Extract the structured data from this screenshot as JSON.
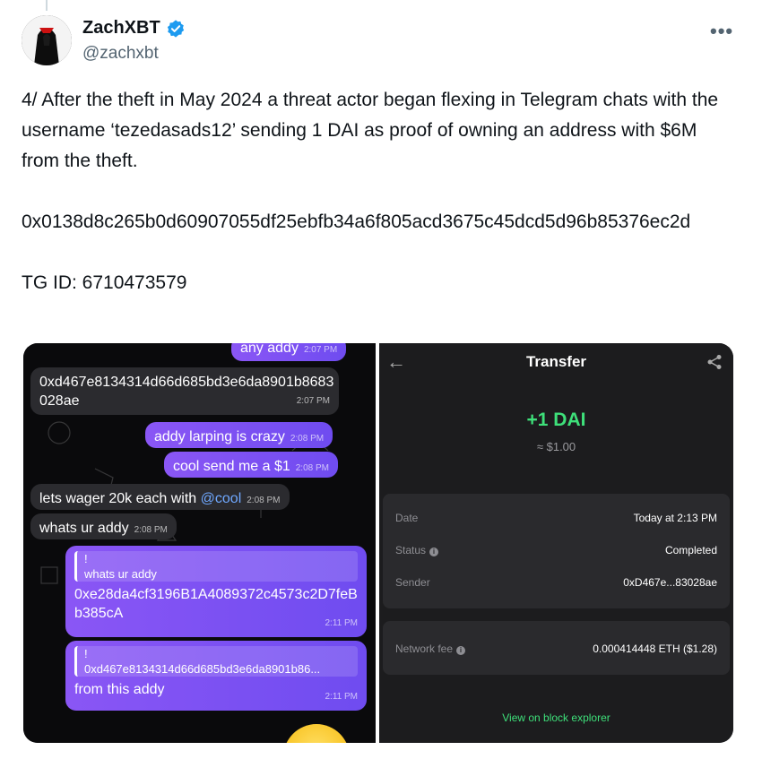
{
  "author": {
    "name": "ZachXBT",
    "handle": "@zachxbt"
  },
  "more_label": "•••",
  "tweet": {
    "lines": [
      "4/ After the theft in May 2024 a threat actor began flexing in Telegram chats with the username ‘tezedasads12’ sending 1 DAI as proof of owning an address with $6M from the theft.",
      "0x0138d8c265b0d60907055df25ebfb34a6f805acd3675c45dcd5d96b85376ec2d",
      "TG ID: 6710473579"
    ]
  },
  "telegram": {
    "messages": [
      {
        "text": "any addy",
        "time": "2:07 PM"
      },
      {
        "text": "0xd467e8134314d66d685bd3e6da8901b8683028ae",
        "time": "2:07 PM"
      },
      {
        "text": "addy larping is crazy",
        "time": "2:08 PM"
      },
      {
        "text": "cool send me a $1",
        "time": "2:08 PM"
      },
      {
        "text_before": "lets wager 20k each with ",
        "mention": "@cool",
        "time": "2:08 PM"
      },
      {
        "text": "whats ur addy",
        "time": "2:08 PM"
      },
      {
        "quote_mark": "!",
        "quote": "whats ur addy",
        "text": "0xe28da4cf3196B1A4089372c4573c2D7feBb385cA",
        "time": "2:11 PM"
      },
      {
        "quote_mark": "!",
        "quote": "0xd467e8134314d66d685bd3e6da8901b86...",
        "text": "from this addy",
        "time": "2:11 PM"
      }
    ]
  },
  "transfer": {
    "back_icon": "arrow-left-icon",
    "title": "Transfer",
    "amount": "+1 DAI",
    "usd": "≈ $1.00",
    "rows": [
      {
        "label": "Date",
        "value": "Today at 2:13 PM"
      },
      {
        "label": "Status",
        "value": "Completed"
      },
      {
        "label": "Sender",
        "value": "0xD467e...83028ae"
      }
    ],
    "fee": {
      "label": "Network fee",
      "value": "0.000414448 ETH ($1.28)"
    },
    "explorer": "View on block explorer",
    "accent_color": "#3ee07a"
  },
  "colors": {
    "verified": "#1d9bf0",
    "handle": "#536471",
    "bubble_out": "#7c4dff",
    "bubble_in": "#2b2b2f"
  }
}
